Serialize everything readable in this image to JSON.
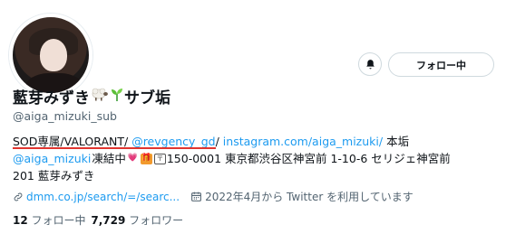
{
  "profile": {
    "name": "藍芽みずき",
    "name_suffix": "サブ垢",
    "handle": "@aiga_mizuki_sub"
  },
  "actions": {
    "follow_label": "フォロー中"
  },
  "bio": {
    "line1": {
      "underlined_text": "SOD専属/VALORANT/",
      "mention": "@revgency_gd",
      "slash": "/",
      "link": "instagram.com/aiga_mizuki/",
      "tail": "本垢"
    },
    "line2": {
      "mention": "@aiga_mizuki",
      "text1": "凍結中",
      "text2": "150-0001 東京都渋谷区神宮前 1-10-6 セリジェ神宮前"
    },
    "line3": {
      "text": "201 藍芽みずき"
    }
  },
  "meta": {
    "website": "dmm.co.jp/search/=/searc...",
    "joined": "2022年4月から Twitter を利用しています"
  },
  "stats": {
    "following_count": "12",
    "following_label": "フォロー中",
    "followers_count": "7,729",
    "followers_label": "フォロワー"
  },
  "colors": {
    "link": "#1d9bf0",
    "underline": "#e0352f",
    "muted": "#536471"
  }
}
